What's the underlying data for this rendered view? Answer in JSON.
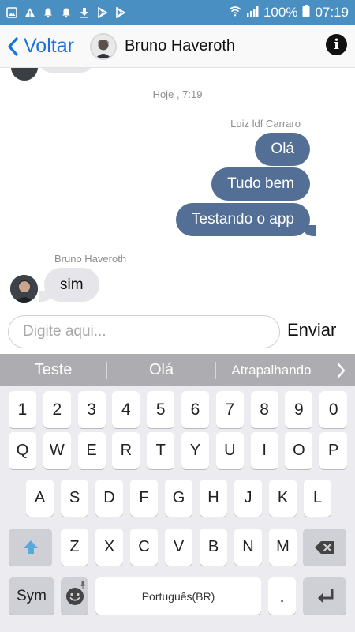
{
  "status_bar": {
    "battery": "100%",
    "time": "07:19",
    "icons": [
      "image-icon",
      "warning-icon",
      "bell-icon",
      "bell-icon",
      "download-icon",
      "play-store-icon",
      "play-store-icon",
      "wifi-icon",
      "signal-icon",
      "battery-icon"
    ]
  },
  "header": {
    "back_label": "Voltar",
    "contact_name": "Bruno Haveroth",
    "info_icon": "info-icon"
  },
  "chat": {
    "date_separator": "Hoje , 7:19",
    "outgoing_sender": "Luiz ldf Carraro",
    "outgoing_messages": [
      "Olá",
      "Tudo bem",
      "Testando o app"
    ],
    "incoming_sender": "Bruno Haveroth",
    "incoming_messages": [
      "sim"
    ]
  },
  "composer": {
    "placeholder": "Digite aqui...",
    "send_label": "Enviar"
  },
  "suggestions": {
    "items": [
      "Teste",
      "Olá",
      "Atrapalhando"
    ],
    "next_icon": "chevron-right-icon"
  },
  "keyboard": {
    "row_numbers": [
      "1",
      "2",
      "3",
      "4",
      "5",
      "6",
      "7",
      "8",
      "9",
      "0"
    ],
    "row_1": [
      "Q",
      "W",
      "E",
      "R",
      "T",
      "Y",
      "U",
      "I",
      "O",
      "P"
    ],
    "row_2": [
      "A",
      "S",
      "D",
      "F",
      "G",
      "H",
      "J",
      "K",
      "L"
    ],
    "row_3": [
      "Z",
      "X",
      "C",
      "V",
      "B",
      "N",
      "M"
    ],
    "sym_label": "Sym",
    "space_label": "Português(BR)",
    "period_label": ".",
    "shift_icon": "shift-arrow-icon",
    "backspace_icon": "backspace-icon",
    "emoji_icon": "emoji-icon",
    "mic_icon": "mic-icon",
    "enter_icon": "enter-icon"
  },
  "colors": {
    "status_bar": "#4a8fc2",
    "outgoing_bubble": "#536f95",
    "incoming_bubble": "#e6e6ea",
    "back_link": "#1a73d9",
    "suggestion_bar": "#adadb1",
    "shift_arrow": "#5aa9dd"
  }
}
